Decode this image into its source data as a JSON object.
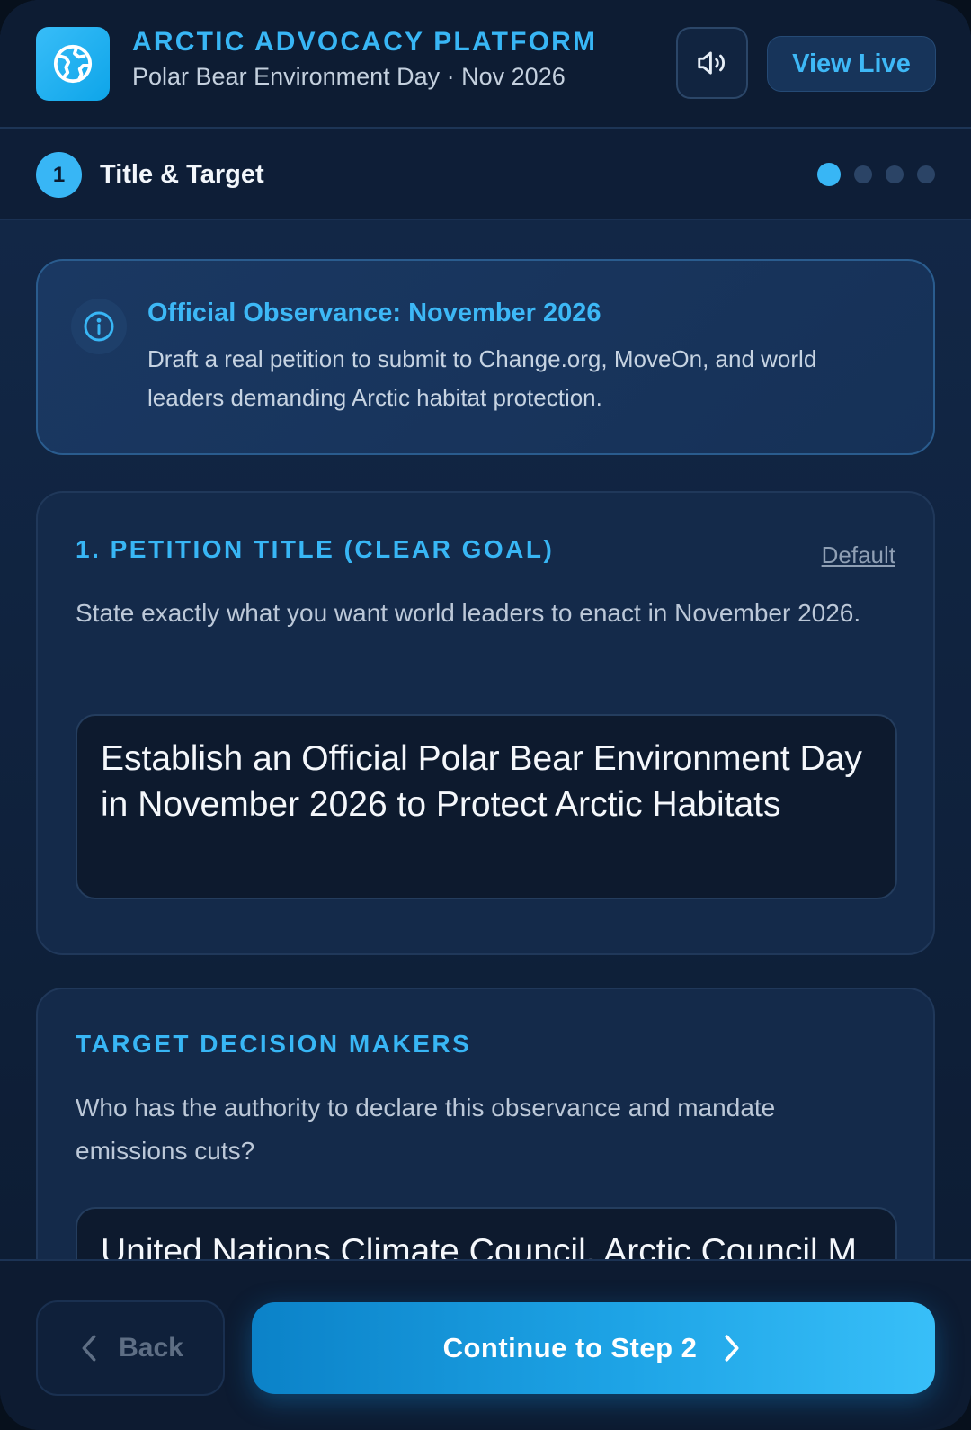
{
  "header": {
    "app_title": "ARCTIC ADVOCACY PLATFORM",
    "subtitle": "Polar Bear Environment Day · Nov 2026",
    "logo_icon": "globe-icon",
    "sound_icon": "speaker-icon",
    "view_live_label": "View Live"
  },
  "step": {
    "number": "1",
    "title": "Title & Target",
    "current": 1,
    "total": 4
  },
  "info": {
    "icon": "info-icon",
    "title": "Official Observance: November 2026",
    "body": "Draft a real petition to submit to Change.org, MoveOn, and world leaders demanding Arctic habitat protection."
  },
  "petition_title": {
    "heading": "1. PETITION TITLE (CLEAR GOAL)",
    "default_label": "Default",
    "description": "State exactly what you want world leaders to enact in November 2026.",
    "value": "Establish an Official Polar Bear Environment Day in November 2026 to Protect Arctic Habitats"
  },
  "targets": {
    "heading": "TARGET DECISION MAKERS",
    "description": "Who has the authority to declare this observance and mandate emissions cuts?",
    "value": "United Nations Climate Council, Arctic Council M"
  },
  "footer": {
    "back_label": "Back",
    "continue_label": "Continue to Step 2"
  },
  "colors": {
    "accent": "#38b6f5",
    "background": "#10233f",
    "card": "#142a4a"
  }
}
